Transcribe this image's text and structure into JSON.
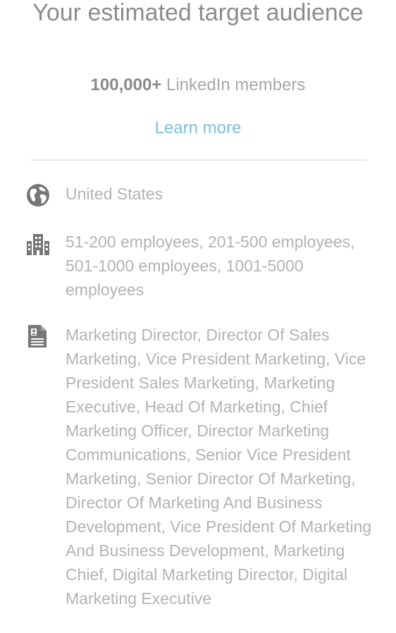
{
  "header": {
    "title": "Your estimated target audience",
    "reach_count": "100,000+",
    "reach_label": "LinkedIn members",
    "learn_more": "Learn more"
  },
  "criteria": {
    "location": {
      "icon": "globe-icon",
      "text": "United States"
    },
    "company_size": {
      "icon": "building-icon",
      "text": "51-200 employees, 201-500 employees, 501-1000 employees, 1001-5000 employees"
    },
    "job_titles": {
      "icon": "document-profile-icon",
      "text": "Marketing Director, Director Of Sales Marketing, Vice President Marketing, Vice President Sales Marketing, Marketing Executive, Head Of Marketing, Chief Marketing Officer, Director Marketing Communications, Senior Vice President Marketing, Senior Director Of Marketing, Director Of Marketing And Business Development, Vice President Of Marketing And Business Development, Marketing Chief, Digital Marketing Director, Digital Marketing Executive"
    }
  },
  "colors": {
    "link": "#7cc0df",
    "icon": "#767676",
    "divider": "#e6e6e6"
  }
}
